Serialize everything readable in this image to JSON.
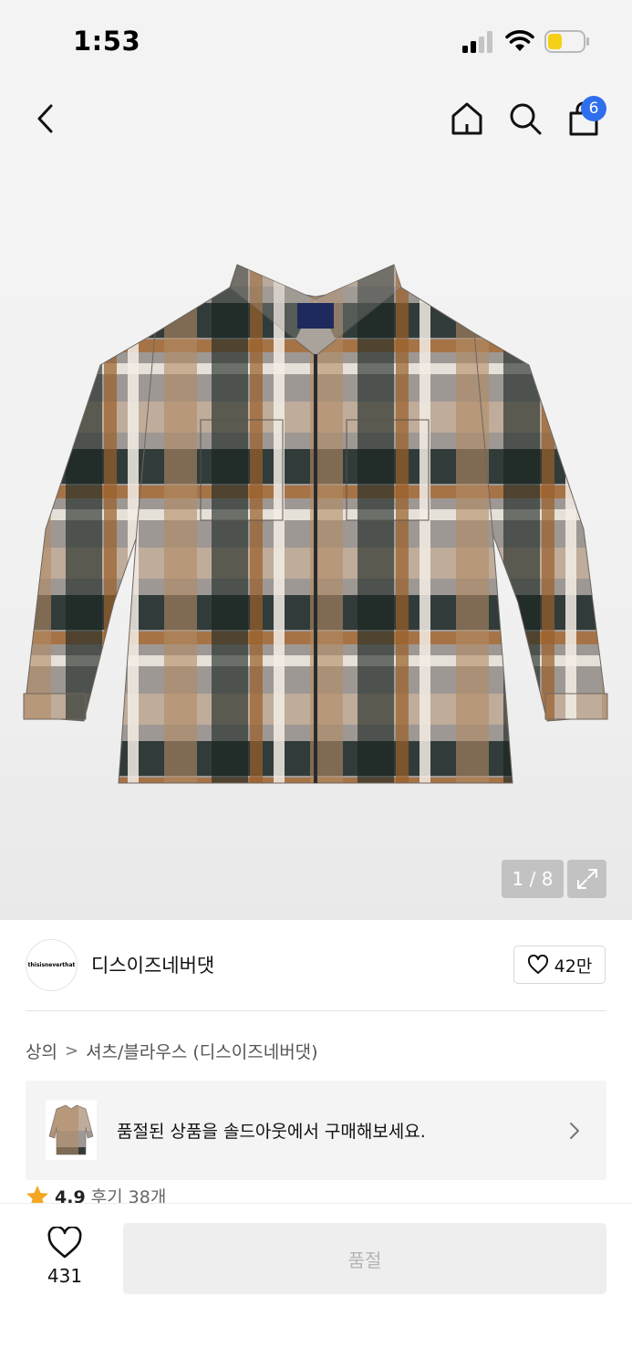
{
  "status_bar": {
    "time": "1:53",
    "battery_color": "#f6cf17"
  },
  "nav": {
    "back_icon": "chevron-left-icon",
    "home_icon": "home-icon",
    "search_icon": "search-icon",
    "bag_icon": "shopping-bag-icon",
    "bag_badge": "6",
    "badge_color": "#2f6fee"
  },
  "gallery": {
    "counter": "1 / 8",
    "expand_icon": "expand-icon"
  },
  "brand": {
    "logo_text": "thisisneverthat",
    "name": "디스이즈네버댓",
    "like_count": "42만"
  },
  "breadcrumb": {
    "items": [
      "상의",
      "셔츠/블라우스 (디스이즈네버댓)"
    ],
    "separator": ">"
  },
  "soldout_banner": {
    "text": "품절된 상품을 솔드아웃에서 구매해보세요."
  },
  "rating": {
    "value": "4.9",
    "review_label": "후기 38개",
    "star_color": "#f5a623"
  },
  "bottom": {
    "wish_count": "431",
    "buy_label": "품절"
  }
}
